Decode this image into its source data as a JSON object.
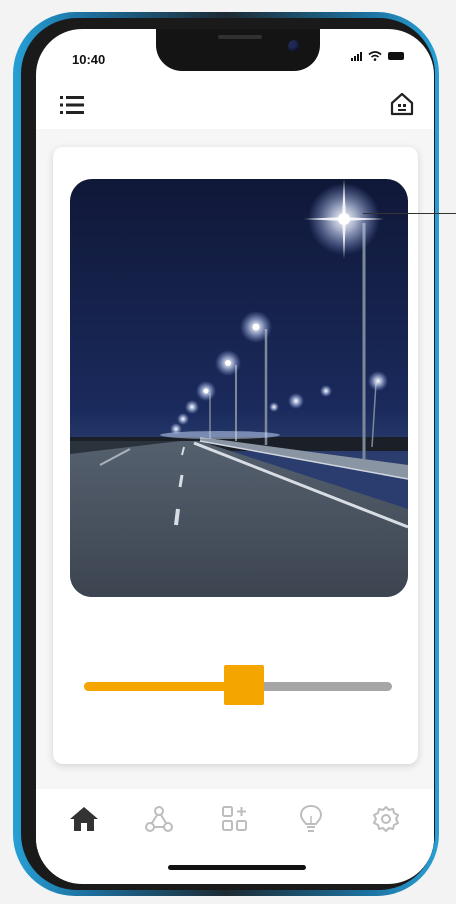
{
  "status_bar": {
    "time": "10:40"
  },
  "header": {
    "menu_icon": "hamburger-menu-icon",
    "home_icon": "smart-home-icon"
  },
  "main": {
    "image_subject": "streetlights-at-night",
    "brightness_slider": {
      "value_fraction": 0.52
    }
  },
  "bottom_nav": {
    "items": [
      {
        "icon": "home-icon",
        "active": true
      },
      {
        "icon": "network-nodes-icon",
        "active": false
      },
      {
        "icon": "add-device-icon",
        "active": false
      },
      {
        "icon": "lightbulb-icon",
        "active": false
      },
      {
        "icon": "settings-icon",
        "active": false
      }
    ]
  },
  "colors": {
    "accent": "#f5a500",
    "track": "#a6a6a6",
    "frame_blue": "#27a0d6",
    "active_nav": "#333333",
    "inactive_nav": "#bdbdbd"
  }
}
